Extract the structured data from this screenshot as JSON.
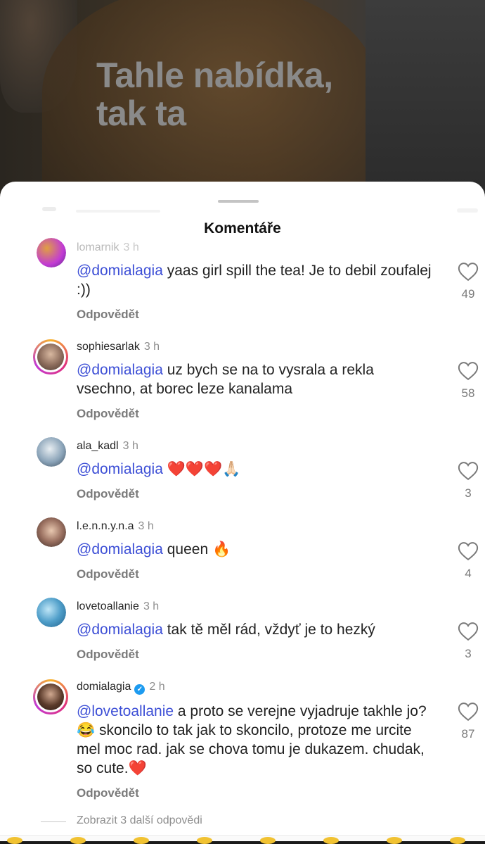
{
  "video": {
    "caption_line1": "Tahle nabídka,",
    "caption_line2": "tak ta"
  },
  "sheet": {
    "title": "Komentáře"
  },
  "comments": [
    {
      "username": "lomarnik",
      "time": "3 h",
      "mention": "@domialagia",
      "text": " yaas girl spill the tea! Je to debil zoufalej :))",
      "reply_label": "Odpovědět",
      "likes": "49",
      "avatar_color": "#8e5ab8"
    },
    {
      "username": "sophiesarlak",
      "time": "3 h",
      "mention": "@domialagia",
      "text": " uz bych se na to vysrala a rekla vsechno, at borec leze kanalama",
      "reply_label": "Odpovědět",
      "likes": "58",
      "avatar_color": "#8a6a5a"
    },
    {
      "username": "ala_kadl",
      "time": "3 h",
      "mention": "@domialagia",
      "text": " ❤️❤️❤️🙏🏻",
      "reply_label": "Odpovědět",
      "likes": "3",
      "avatar_color": "#7f97ad"
    },
    {
      "username": "l.e.n.n.y.n.a",
      "time": "3 h",
      "mention": "@domialagia",
      "text": " queen 🔥",
      "reply_label": "Odpovědět",
      "likes": "4",
      "avatar_color": "#a08070"
    },
    {
      "username": "lovetoallanie",
      "time": "3 h",
      "mention": "@domialagia",
      "text": " tak tě měl rád, vždyť je to hezký",
      "reply_label": "Odpovědět",
      "likes": "3",
      "avatar_color": "#4f9ec9"
    },
    {
      "username": "domialagia",
      "time": "2 h",
      "mention": "@lovetoallanie",
      "text": " a proto se verejne vyjadruje takhle jo?😂 skoncilo to tak jak to skoncilo, protoze me urcite mel moc rad. jak se chova tomu je dukazem. chudak, so cute.❤️",
      "reply_label": "Odpovědět",
      "likes": "87",
      "avatar_color": "#5a3a2a"
    }
  ],
  "more_replies": "Zobrazit 3 další odpovědi",
  "colors": {
    "mention": "#3d4fd6",
    "verified": "#1d9bf0",
    "story_ring": "#e0307c"
  }
}
